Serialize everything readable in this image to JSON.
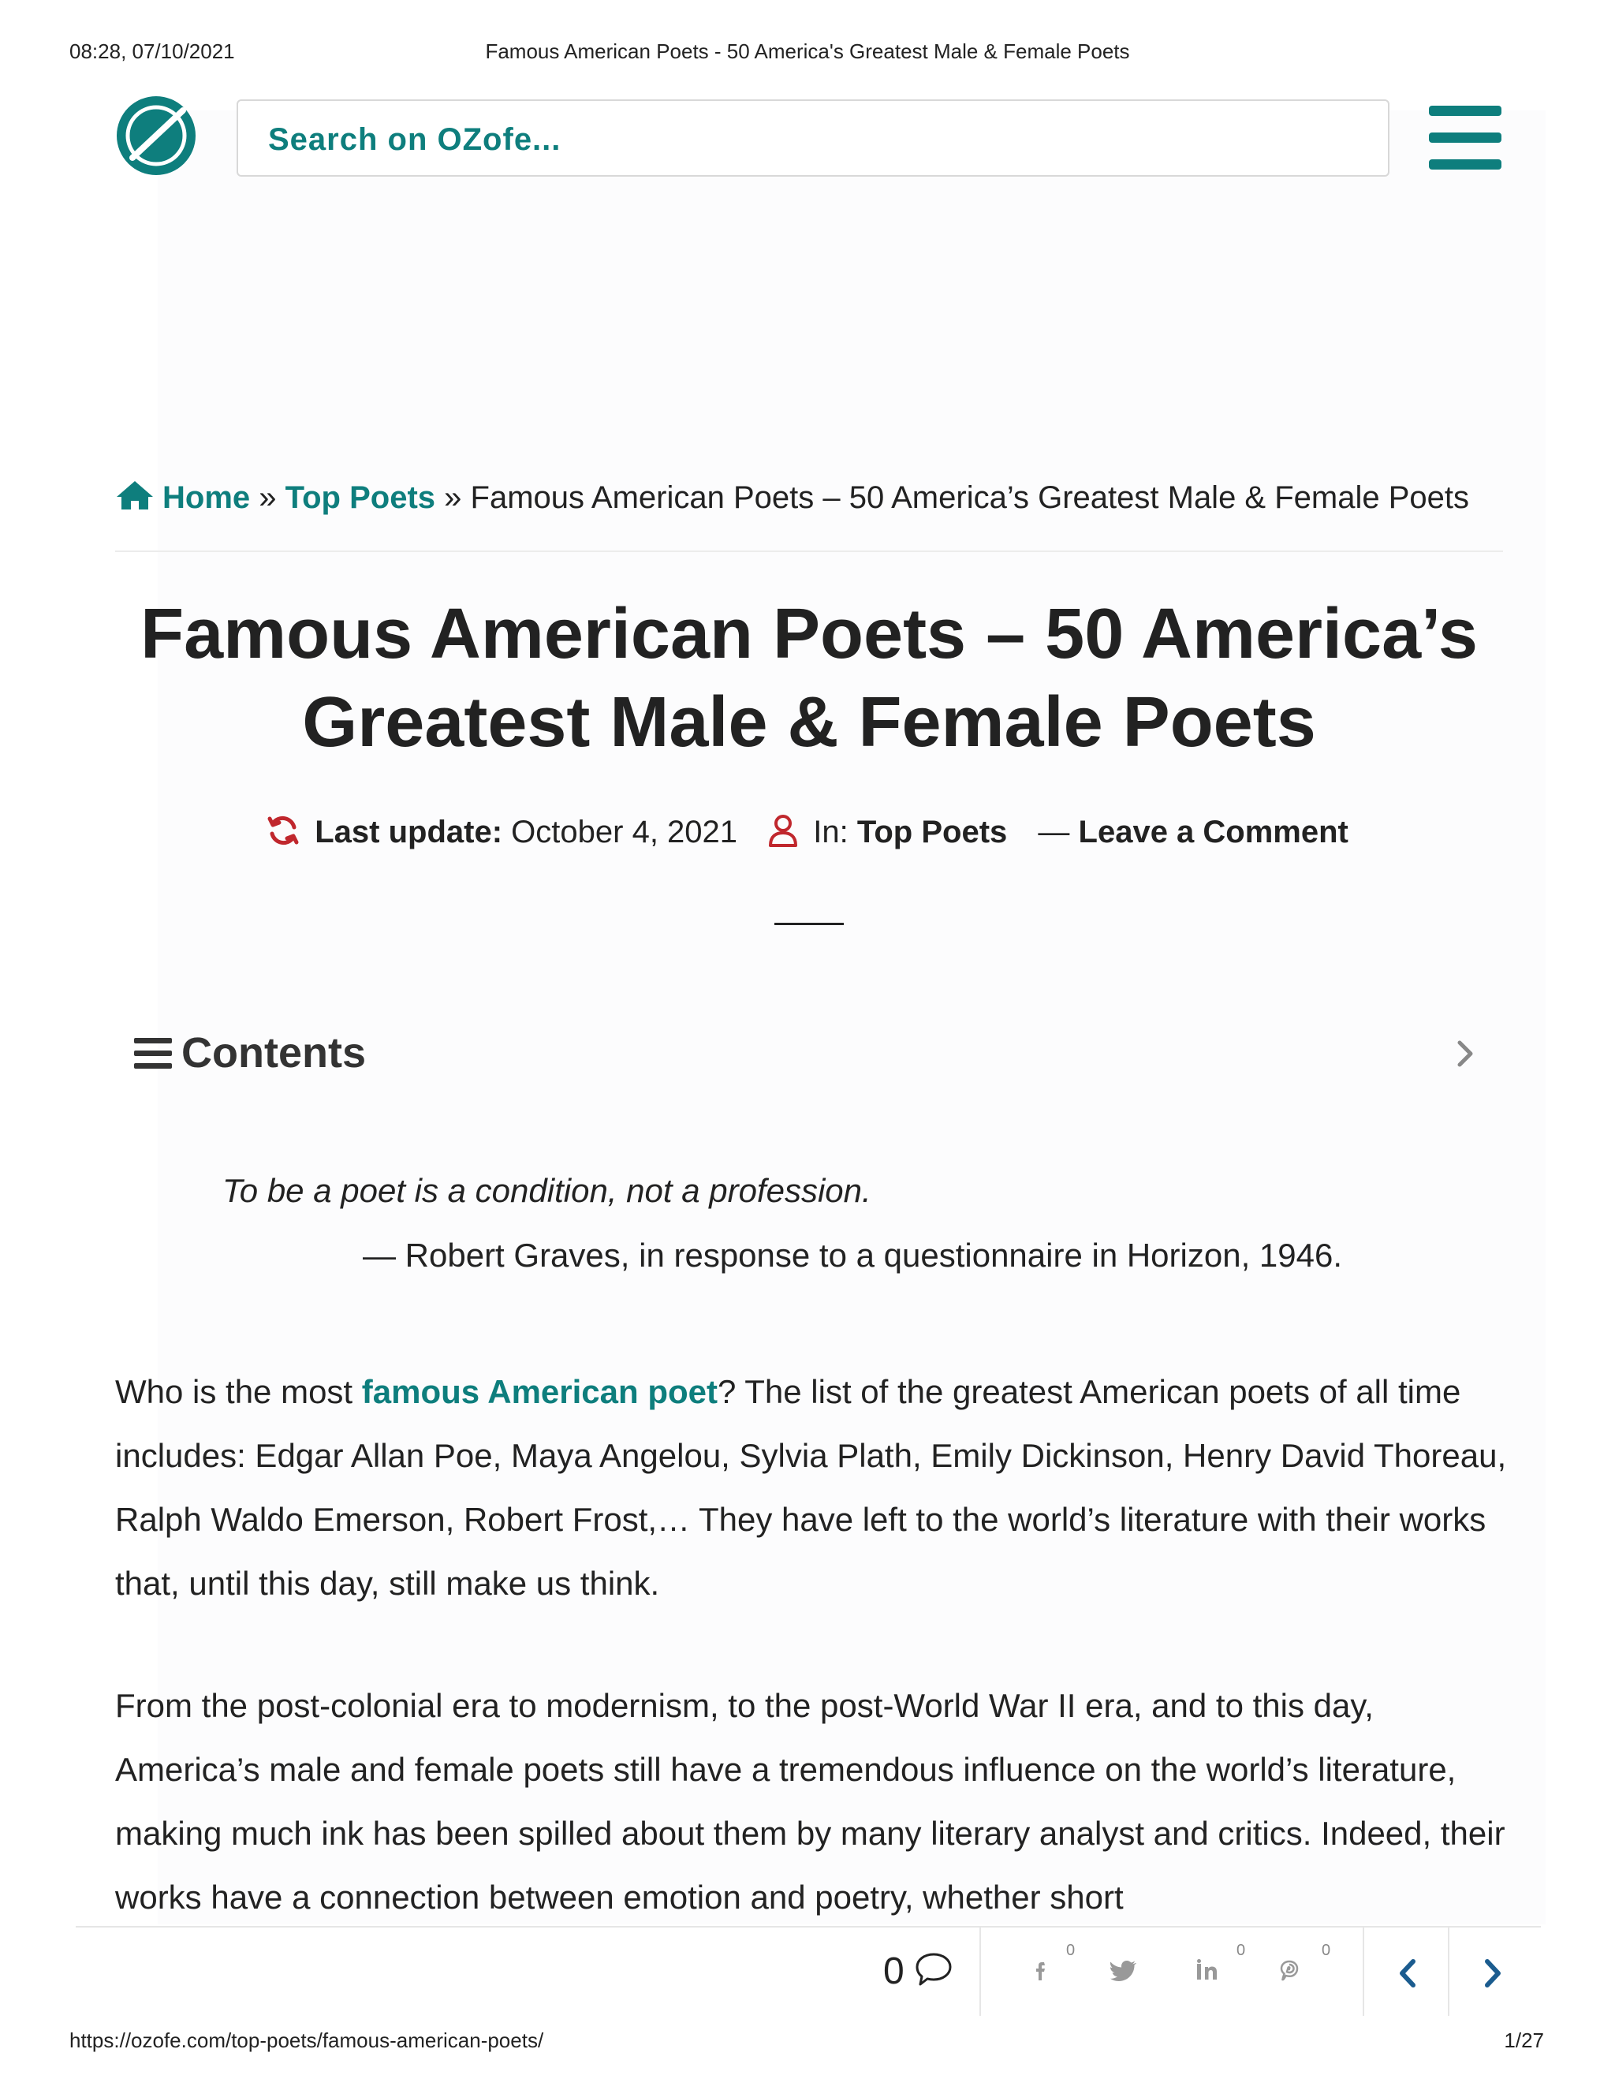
{
  "print_header": {
    "timestamp": "08:28, 07/10/2021",
    "doc_title": "Famous American Poets - 50 America's Greatest Male & Female Poets"
  },
  "header": {
    "logo_icon": "ozofe-logo-icon",
    "search_placeholder": "Search on OZofe...",
    "menu_icon": "hamburger-menu-icon"
  },
  "breadcrumb": {
    "home": "Home",
    "sep": "»",
    "category": "Top Poets",
    "current": "Famous American Poets – 50 America’s Greatest Male & Female Poets"
  },
  "article": {
    "title_line1": "Famous American Poets – 50 America’s",
    "title_line2": "Greatest Male & Female Poets",
    "meta": {
      "updated_label": "Last update:",
      "updated_date": "October 4, 2021",
      "in_label": "In:",
      "category": "Top Poets",
      "comment_prefix": "—",
      "comment_link": "Leave a Comment"
    },
    "contents_label": "Contents",
    "quote": "To be a poet is a condition, not a profession.",
    "attribution": "— Robert Graves, in response to a questionnaire in Horizon, 1946.",
    "para1": {
      "before": "Who is the most ",
      "link": "famous American poet",
      "after": "? The list of the greatest American poets of all time includes: Edgar Allan Poe, Maya Angelou, Sylvia Plath, Emily Dickinson, Henry David Thoreau, Ralph Waldo Emerson, Robert Frost,… They have left to the world’s literature with their works that, until this day, still make us think."
    },
    "para2": "From the post-colonial era to modernism, to the post-World War II era, and to this day, America’s male and female poets still have a tremendous influence on the world’s literature, making much ink has been spilled about them by many literary analyst and critics. Indeed, their works have a connection between emotion and poetry, whether short"
  },
  "share_bar": {
    "comment_count": "0",
    "facebook_count": "0",
    "pinterest_count": "0",
    "reddit_count": "0"
  },
  "print_footer": {
    "url": "https://ozofe.com/top-poets/famous-american-poets/",
    "page": "1/27"
  },
  "colors": {
    "brand_teal": "#0e7e7d",
    "meta_red": "#c0272d",
    "nav_blue": "#1b5c8f"
  }
}
